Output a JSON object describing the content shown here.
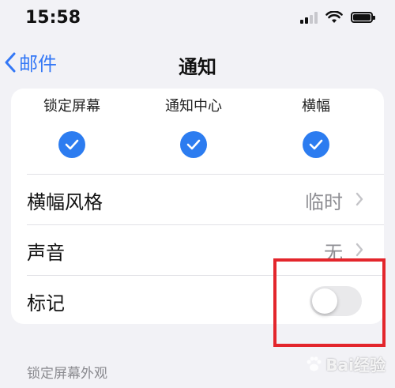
{
  "status_bar": {
    "time": "15:58"
  },
  "nav": {
    "back_label": "邮件",
    "title": "通知"
  },
  "alerts": [
    {
      "label": "锁定屏幕",
      "checked": true
    },
    {
      "label": "通知中心",
      "checked": true
    },
    {
      "label": "横幅",
      "checked": true
    }
  ],
  "rows": {
    "banner_style": {
      "label": "横幅风格",
      "value": "临时"
    },
    "sound": {
      "label": "声音",
      "value": "无"
    },
    "badges": {
      "label": "标记",
      "enabled": false
    }
  },
  "section_header": "锁定屏幕外观",
  "watermark": {
    "text": "Bai经验"
  },
  "colors": {
    "accent": "#3478f6",
    "check": "#2c7cf0",
    "highlight": "#e3262c"
  }
}
